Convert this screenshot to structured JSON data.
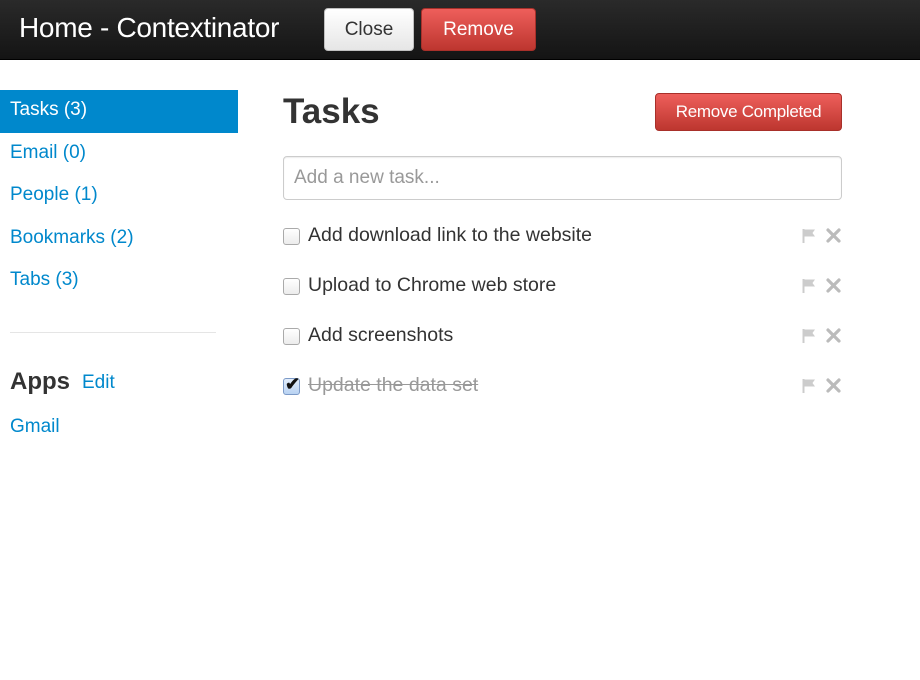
{
  "header": {
    "title": "Home - Contextinator",
    "close_label": "Close",
    "remove_label": "Remove"
  },
  "sidebar": {
    "items": [
      {
        "label": "Tasks (3)",
        "active": true
      },
      {
        "label": "Email (0)",
        "active": false
      },
      {
        "label": "People (1)",
        "active": false
      },
      {
        "label": "Bookmarks (2)",
        "active": false
      },
      {
        "label": "Tabs (3)",
        "active": false
      }
    ],
    "apps_heading": "Apps",
    "apps_edit_label": "Edit",
    "apps": [
      {
        "label": "Gmail"
      }
    ]
  },
  "main": {
    "title": "Tasks",
    "remove_completed_label": "Remove Completed",
    "new_task_placeholder": "Add a new task...",
    "new_task_value": "",
    "tasks": [
      {
        "text": "Add download link to the website",
        "completed": false
      },
      {
        "text": "Upload to Chrome web store",
        "completed": false
      },
      {
        "text": "Add screenshots",
        "completed": false
      },
      {
        "text": "Update the data set",
        "completed": true
      }
    ]
  },
  "colors": {
    "accent": "#0088cc",
    "danger": "#da4f49",
    "topbar": "#1b1b1b"
  },
  "icons": {
    "task_flag": "flag-icon",
    "task_delete": "close-icon"
  }
}
